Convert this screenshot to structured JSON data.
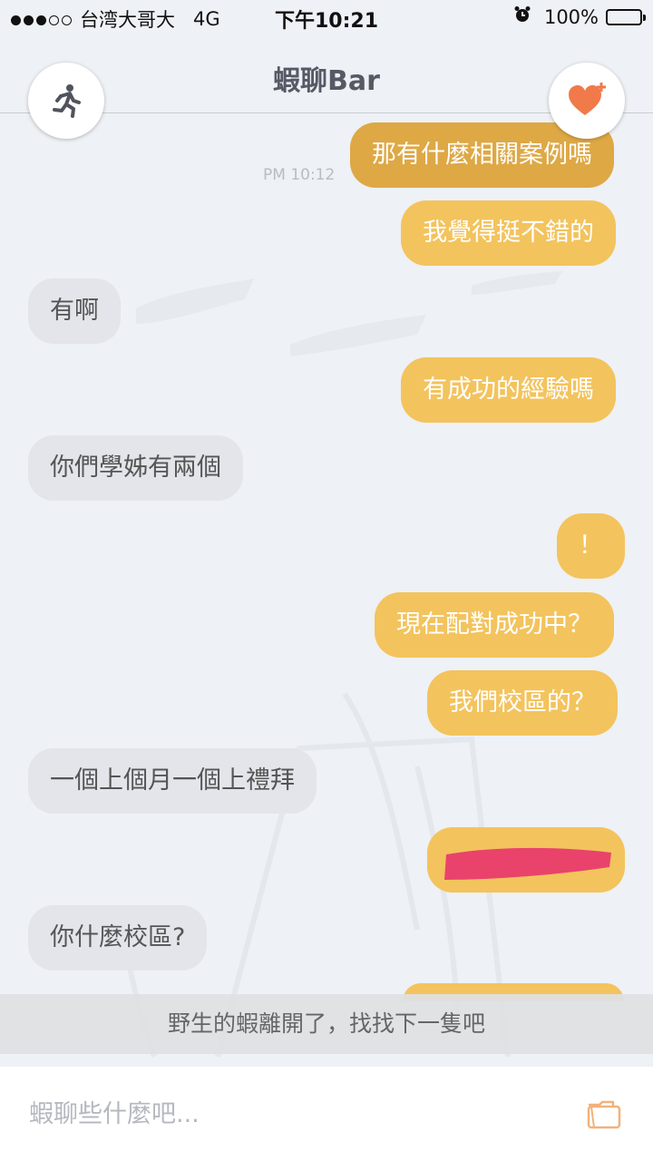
{
  "status_bar": {
    "carrier": "台湾大哥大",
    "network": "4G",
    "time": "下午10:21",
    "battery": "100%",
    "signal_bars": 3,
    "signal_total": 5
  },
  "nav": {
    "title": "蝦聊Bar",
    "leave_icon": "running-man-icon",
    "like_icon": "heart-plus-icon"
  },
  "colors": {
    "sent_bubble": "#f3c35d",
    "sent_bubble_selected": "#dea845",
    "received_bubble": "#e3e5ea",
    "heart": "#f07a4a"
  },
  "messages": [
    {
      "side": "sent",
      "text": "那有什麼相關案例嗎",
      "time": "PM 10:12"
    },
    {
      "side": "sent",
      "text": "我覺得挺不錯的"
    },
    {
      "side": "received",
      "text": "有啊"
    },
    {
      "side": "sent",
      "text": "有成功的經驗嗎"
    },
    {
      "side": "received",
      "text": "你們學姊有兩個"
    },
    {
      "side": "sent",
      "text": "！"
    },
    {
      "side": "sent",
      "text": "現在配對成功中？"
    },
    {
      "side": "sent",
      "text": "我們校區的？"
    },
    {
      "side": "received",
      "text": "一個上個月一個上禮拜"
    },
    {
      "side": "sent",
      "text": "",
      "redacted": true
    },
    {
      "side": "received",
      "text": "你什麼校區?"
    }
  ],
  "notice": "野生的蝦離開了，找找下一隻吧",
  "input": {
    "placeholder": "蝦聊些什麼吧...",
    "value": "",
    "attach_icon": "folder-icon"
  }
}
